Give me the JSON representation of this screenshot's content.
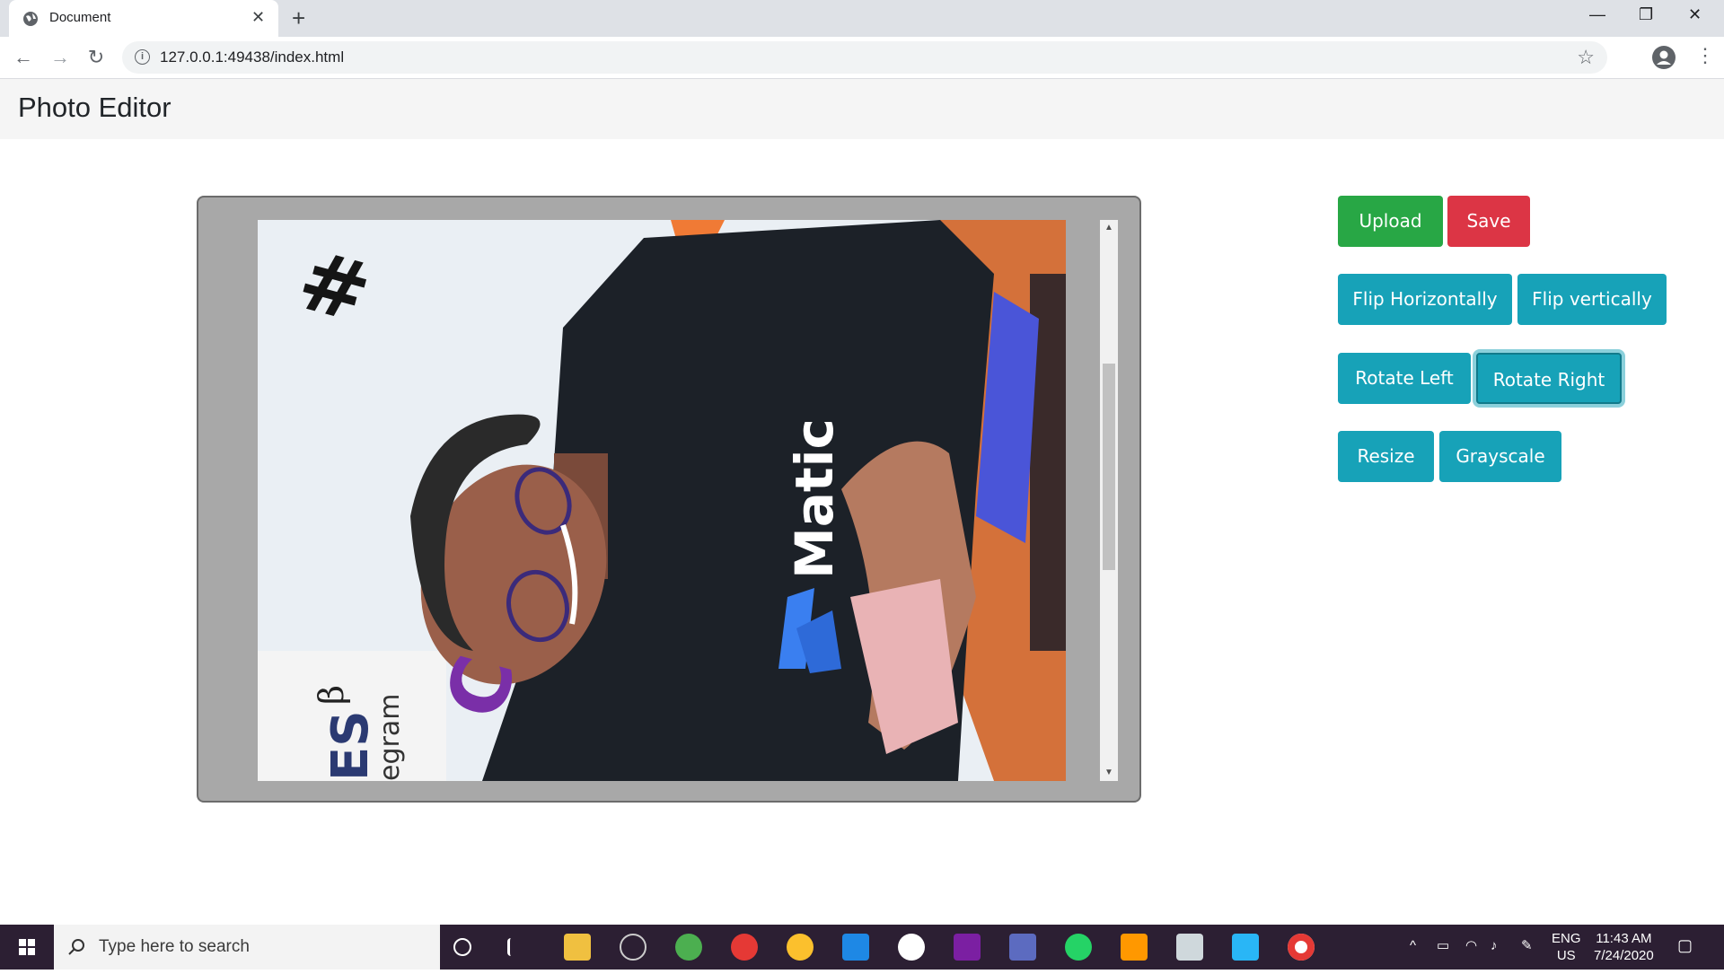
{
  "browser": {
    "tab_title": "Document",
    "url": "127.0.0.1:49438/index.html"
  },
  "page": {
    "title": "Photo Editor"
  },
  "buttons": {
    "upload": "Upload",
    "save": "Save",
    "flip_h": "Flip Horizontally",
    "flip_v": "Flip vertically",
    "rotate_left": "Rotate Left",
    "rotate_right": "Rotate Right",
    "resize": "Resize",
    "grayscale": "Grayscale"
  },
  "image": {
    "shirt_text": "Matic",
    "banner_text": "egram",
    "banner_letters": "ES",
    "hash_mark": "#",
    "beta_mark": "β",
    "purple_mark": "C"
  },
  "taskbar": {
    "search_placeholder": "Type here to search",
    "lang": "ENG",
    "region": "US",
    "time": "11:43 AM",
    "date": "7/24/2020"
  },
  "colors": {
    "upload": "#28a745",
    "save": "#dc3545",
    "tool": "#17a2b8"
  }
}
